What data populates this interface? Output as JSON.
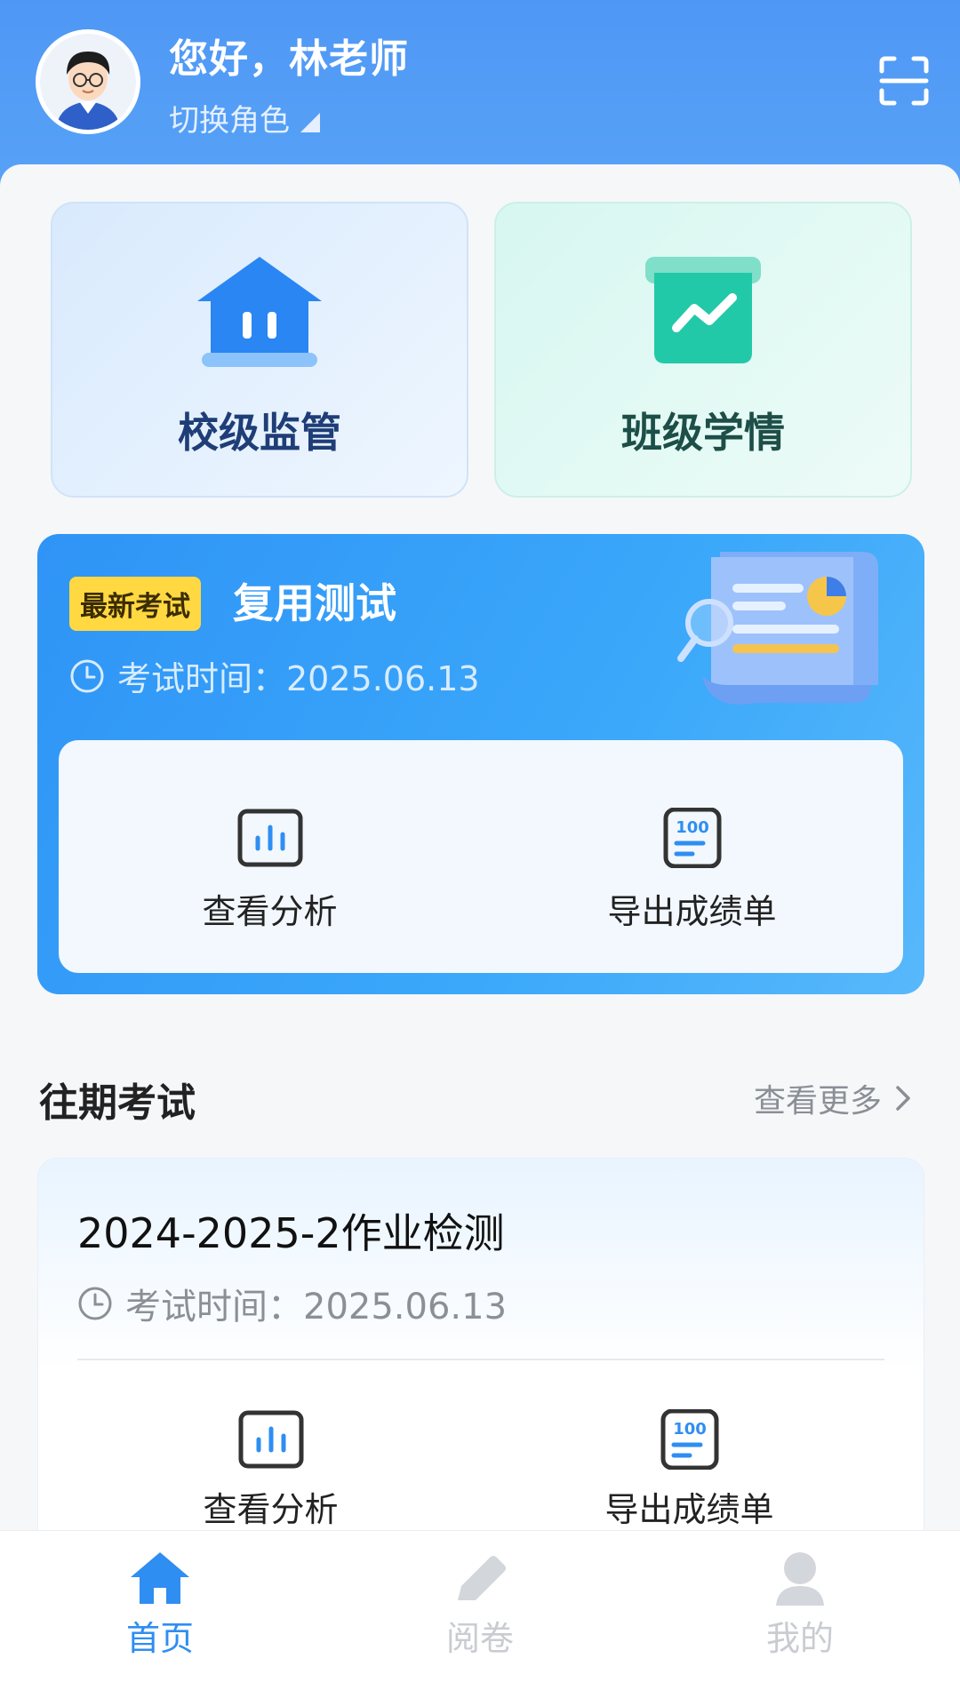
{
  "header": {
    "greeting": "您好，林老师",
    "switch_role": "切换角色"
  },
  "features": [
    {
      "label": "校级监管"
    },
    {
      "label": "班级学情"
    }
  ],
  "latest_exam": {
    "badge": "最新考试",
    "title": "复用测试",
    "time": "考试时间：2025.06.13",
    "actions": [
      "查看分析",
      "导出成绩单"
    ]
  },
  "past_section": {
    "title": "往期考试",
    "more": "查看更多"
  },
  "past_exam": {
    "title": "2024-2025-2作业检测",
    "time": "考试时间：2025.06.13",
    "actions": [
      "查看分析",
      "导出成绩单"
    ]
  },
  "tabbar": {
    "items": [
      {
        "label": "首页",
        "active": true
      },
      {
        "label": "阅卷",
        "active": false
      },
      {
        "label": "我的",
        "active": false
      }
    ]
  },
  "colors": {
    "primary": "#2e8ef2",
    "header": "#4f97f5",
    "badge": "#ffd842",
    "teal": "#22c9a8"
  },
  "icons": [
    "avatar",
    "scan-icon",
    "school-icon",
    "class-trend-icon",
    "clock-icon",
    "report-illustration",
    "chart-icon",
    "score-sheet-icon",
    "chevron-right-icon",
    "home-icon",
    "pen-icon",
    "user-icon"
  ]
}
